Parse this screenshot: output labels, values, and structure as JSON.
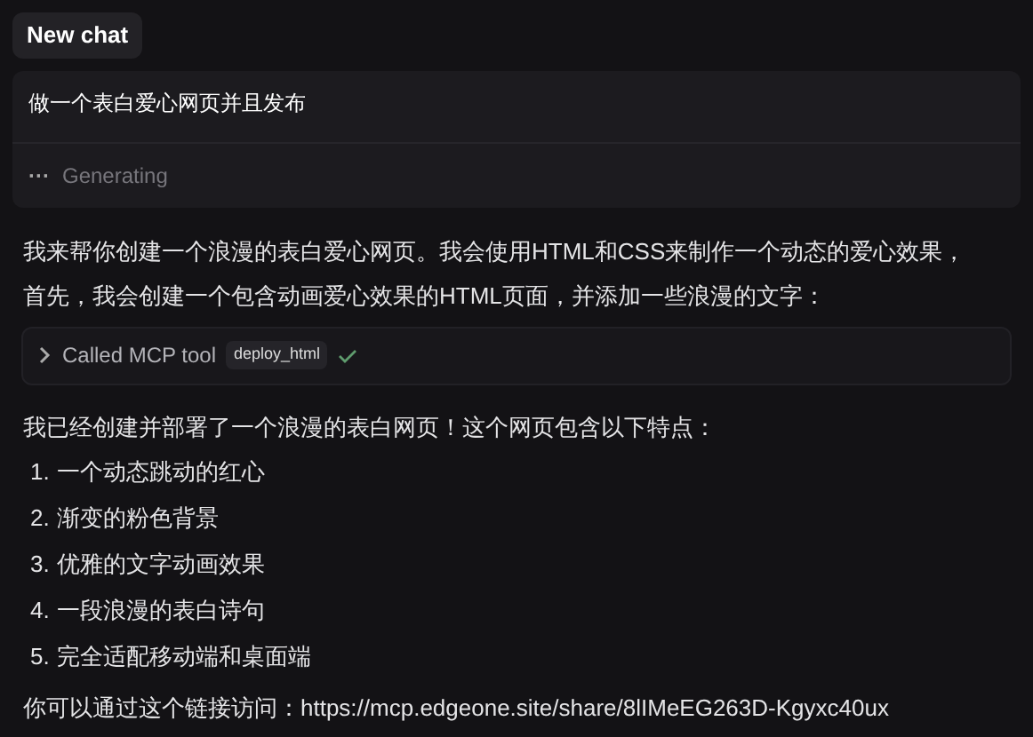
{
  "header": {
    "title": "New chat"
  },
  "prompt": {
    "text": "做一个表白爱心网页并且发布",
    "status_icon": "···",
    "status": "Generating"
  },
  "response": {
    "intro": [
      "我来帮你创建一个浪漫的表白爱心网页。我会使用HTML和CSS来制作一个动态的爱心效果，",
      "首先，我会创建一个包含动画爱心效果的HTML页面，并添加一些浪漫的文字："
    ],
    "tool_call": {
      "label": "Called MCP tool",
      "tool": "deploy_html",
      "expanded": false,
      "succeeded": true
    },
    "summary": "我已经创建并部署了一个浪漫的表白网页！这个网页包含以下特点：",
    "features": [
      {
        "number": "1.",
        "text": "一个动态跳动的红心"
      },
      {
        "number": "2.",
        "text": "渐变的粉色背景"
      },
      {
        "number": "3.",
        "text": "优雅的文字动画效果"
      },
      {
        "number": "4.",
        "text": "一段浪漫的表白诗句"
      },
      {
        "number": "5.",
        "text": "完全适配移动端和桌面端"
      }
    ],
    "link_line": "你可以通过这个链接访问：https://mcp.edgeone.site/share/8lIMeEG263D-Kgyxc40ux"
  }
}
